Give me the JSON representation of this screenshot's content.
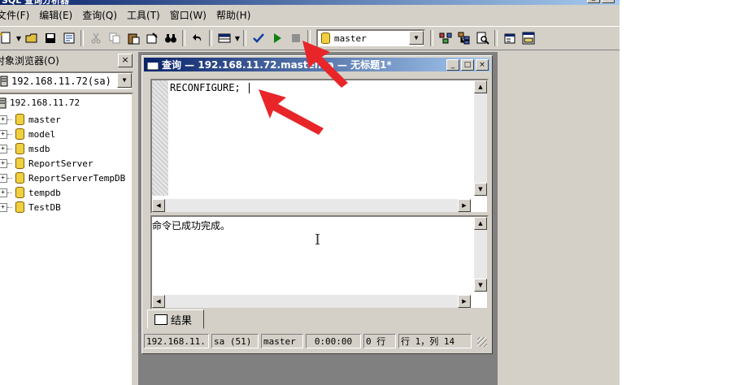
{
  "app": {
    "window_title": "SQL 查询分析器",
    "menu": [
      "文件(F)",
      "编辑(E)",
      "查询(Q)",
      "工具(T)",
      "窗口(W)",
      "帮助(H)"
    ]
  },
  "toolbar": {
    "database": "master"
  },
  "object_browser": {
    "title": "对象浏览器(O)",
    "close": "×",
    "server_select": "192.168.11.72(sa)",
    "tree_root": "192.168.11.72",
    "databases": [
      "master",
      "model",
      "msdb",
      "ReportServer",
      "ReportServerTempDB",
      "tempdb",
      "TestDB"
    ]
  },
  "query_window": {
    "title": "查询 — 192.168.11.72.master.sa — 无标题1*",
    "code": "RECONFIGURE;",
    "result_message": "命令已成功完成。",
    "tab_label": "结果",
    "status": {
      "server": "192.168.11.",
      "user": "sa (51)",
      "database": "master",
      "time": "0:00:00",
      "rows": "0 行",
      "position": "行 1，列 14"
    }
  },
  "colors": {
    "annotation_arrow": "#e8262a",
    "execute_green": "#108010",
    "check_blue": "#1040a0"
  }
}
